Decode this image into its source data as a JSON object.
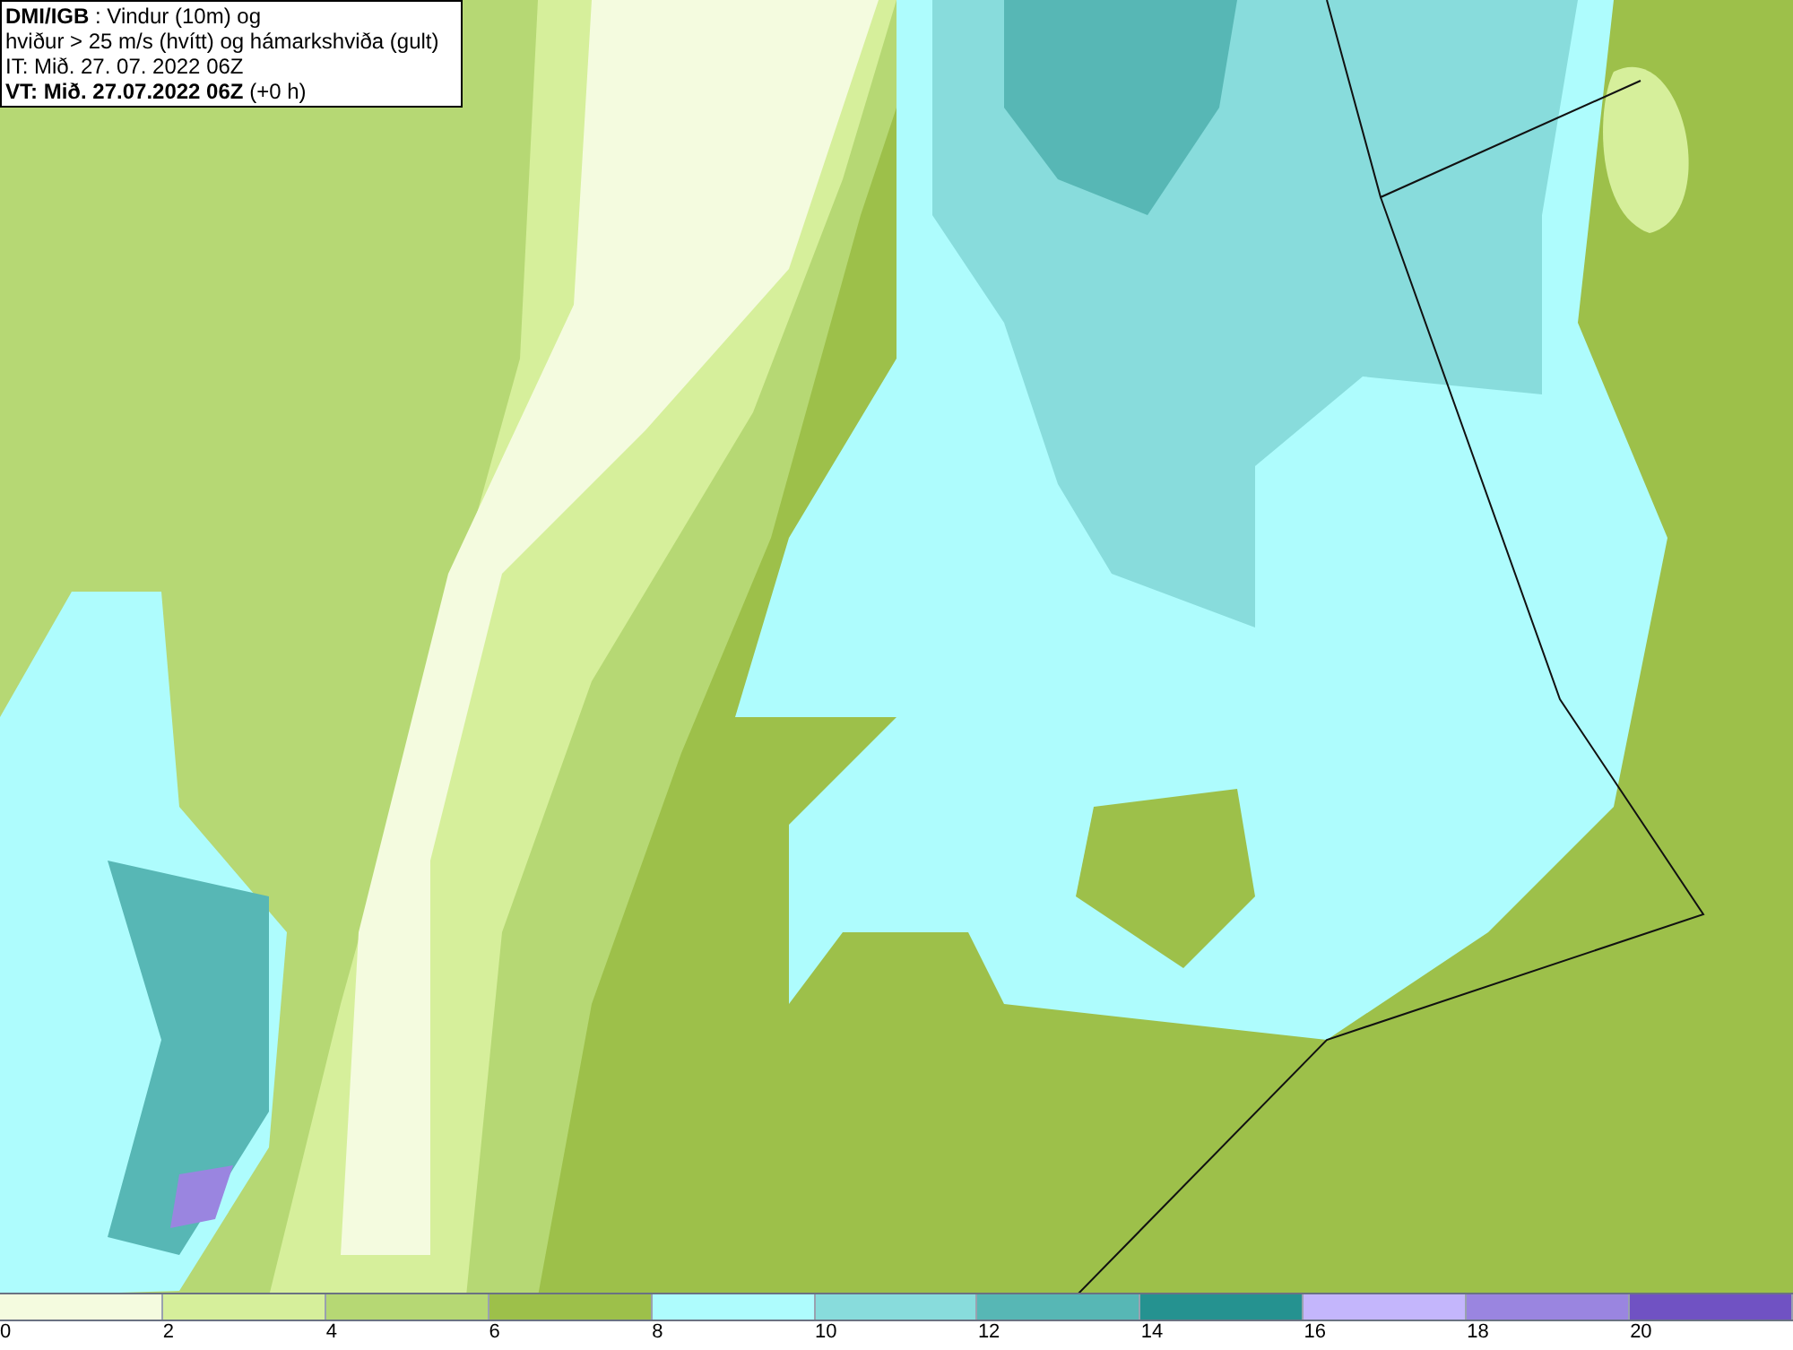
{
  "title_box": {
    "lines": [
      "**DMI/IGB** : Vindur (10m) og",
      "hviður > 25 m/s (hvítt) og hámarkshviða (gult)",
      "IT: Mið. 27. 07. 2022 06Z",
      "**VT: Mið. 27.07.2022 06Z** (+0 h)"
    ]
  },
  "legend": {
    "bins": [
      {
        "label": "0",
        "color": "#f4fbdf"
      },
      {
        "label": "2",
        "color": "#d6ef9b"
      },
      {
        "label": "4",
        "color": "#b6d874"
      },
      {
        "label": "6",
        "color": "#9dc04a"
      },
      {
        "label": "8",
        "color": "#aefcfd"
      },
      {
        "label": "10",
        "color": "#88dcdc"
      },
      {
        "label": "12",
        "color": "#57b7b5"
      },
      {
        "label": "14",
        "color": "#259290"
      },
      {
        "label": "16",
        "color": "#c4b6fc"
      },
      {
        "label": "18",
        "color": "#9a85e0"
      },
      {
        "label": "20",
        "color": "#7052c3"
      }
    ]
  }
}
